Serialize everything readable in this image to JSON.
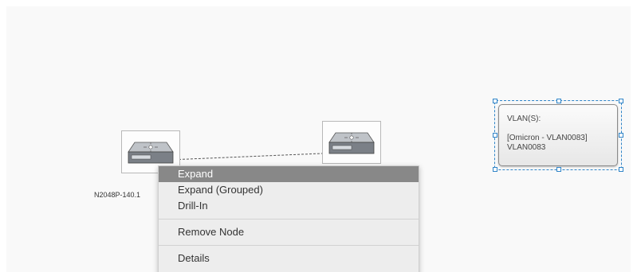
{
  "topology": {
    "nodes": [
      {
        "label": "N2048P-140.1",
        "icon": "switch-icon"
      },
      {
        "label": "",
        "icon": "switch-icon"
      }
    ],
    "vlan_annotation": {
      "title": "VLAN(S):",
      "line1": "[Omicron - VLAN0083]",
      "line2": "VLAN0083"
    }
  },
  "context_menu": {
    "items": [
      {
        "label": "Expand",
        "active": true
      },
      {
        "label": "Expand (Grouped)"
      },
      {
        "label": "Drill-In"
      },
      {
        "label": "Remove Node"
      },
      {
        "label": "Details"
      }
    ]
  },
  "colors": {
    "selection": "#2f84c8",
    "menu_highlight": "#888888",
    "menu_background": "#ededed"
  }
}
